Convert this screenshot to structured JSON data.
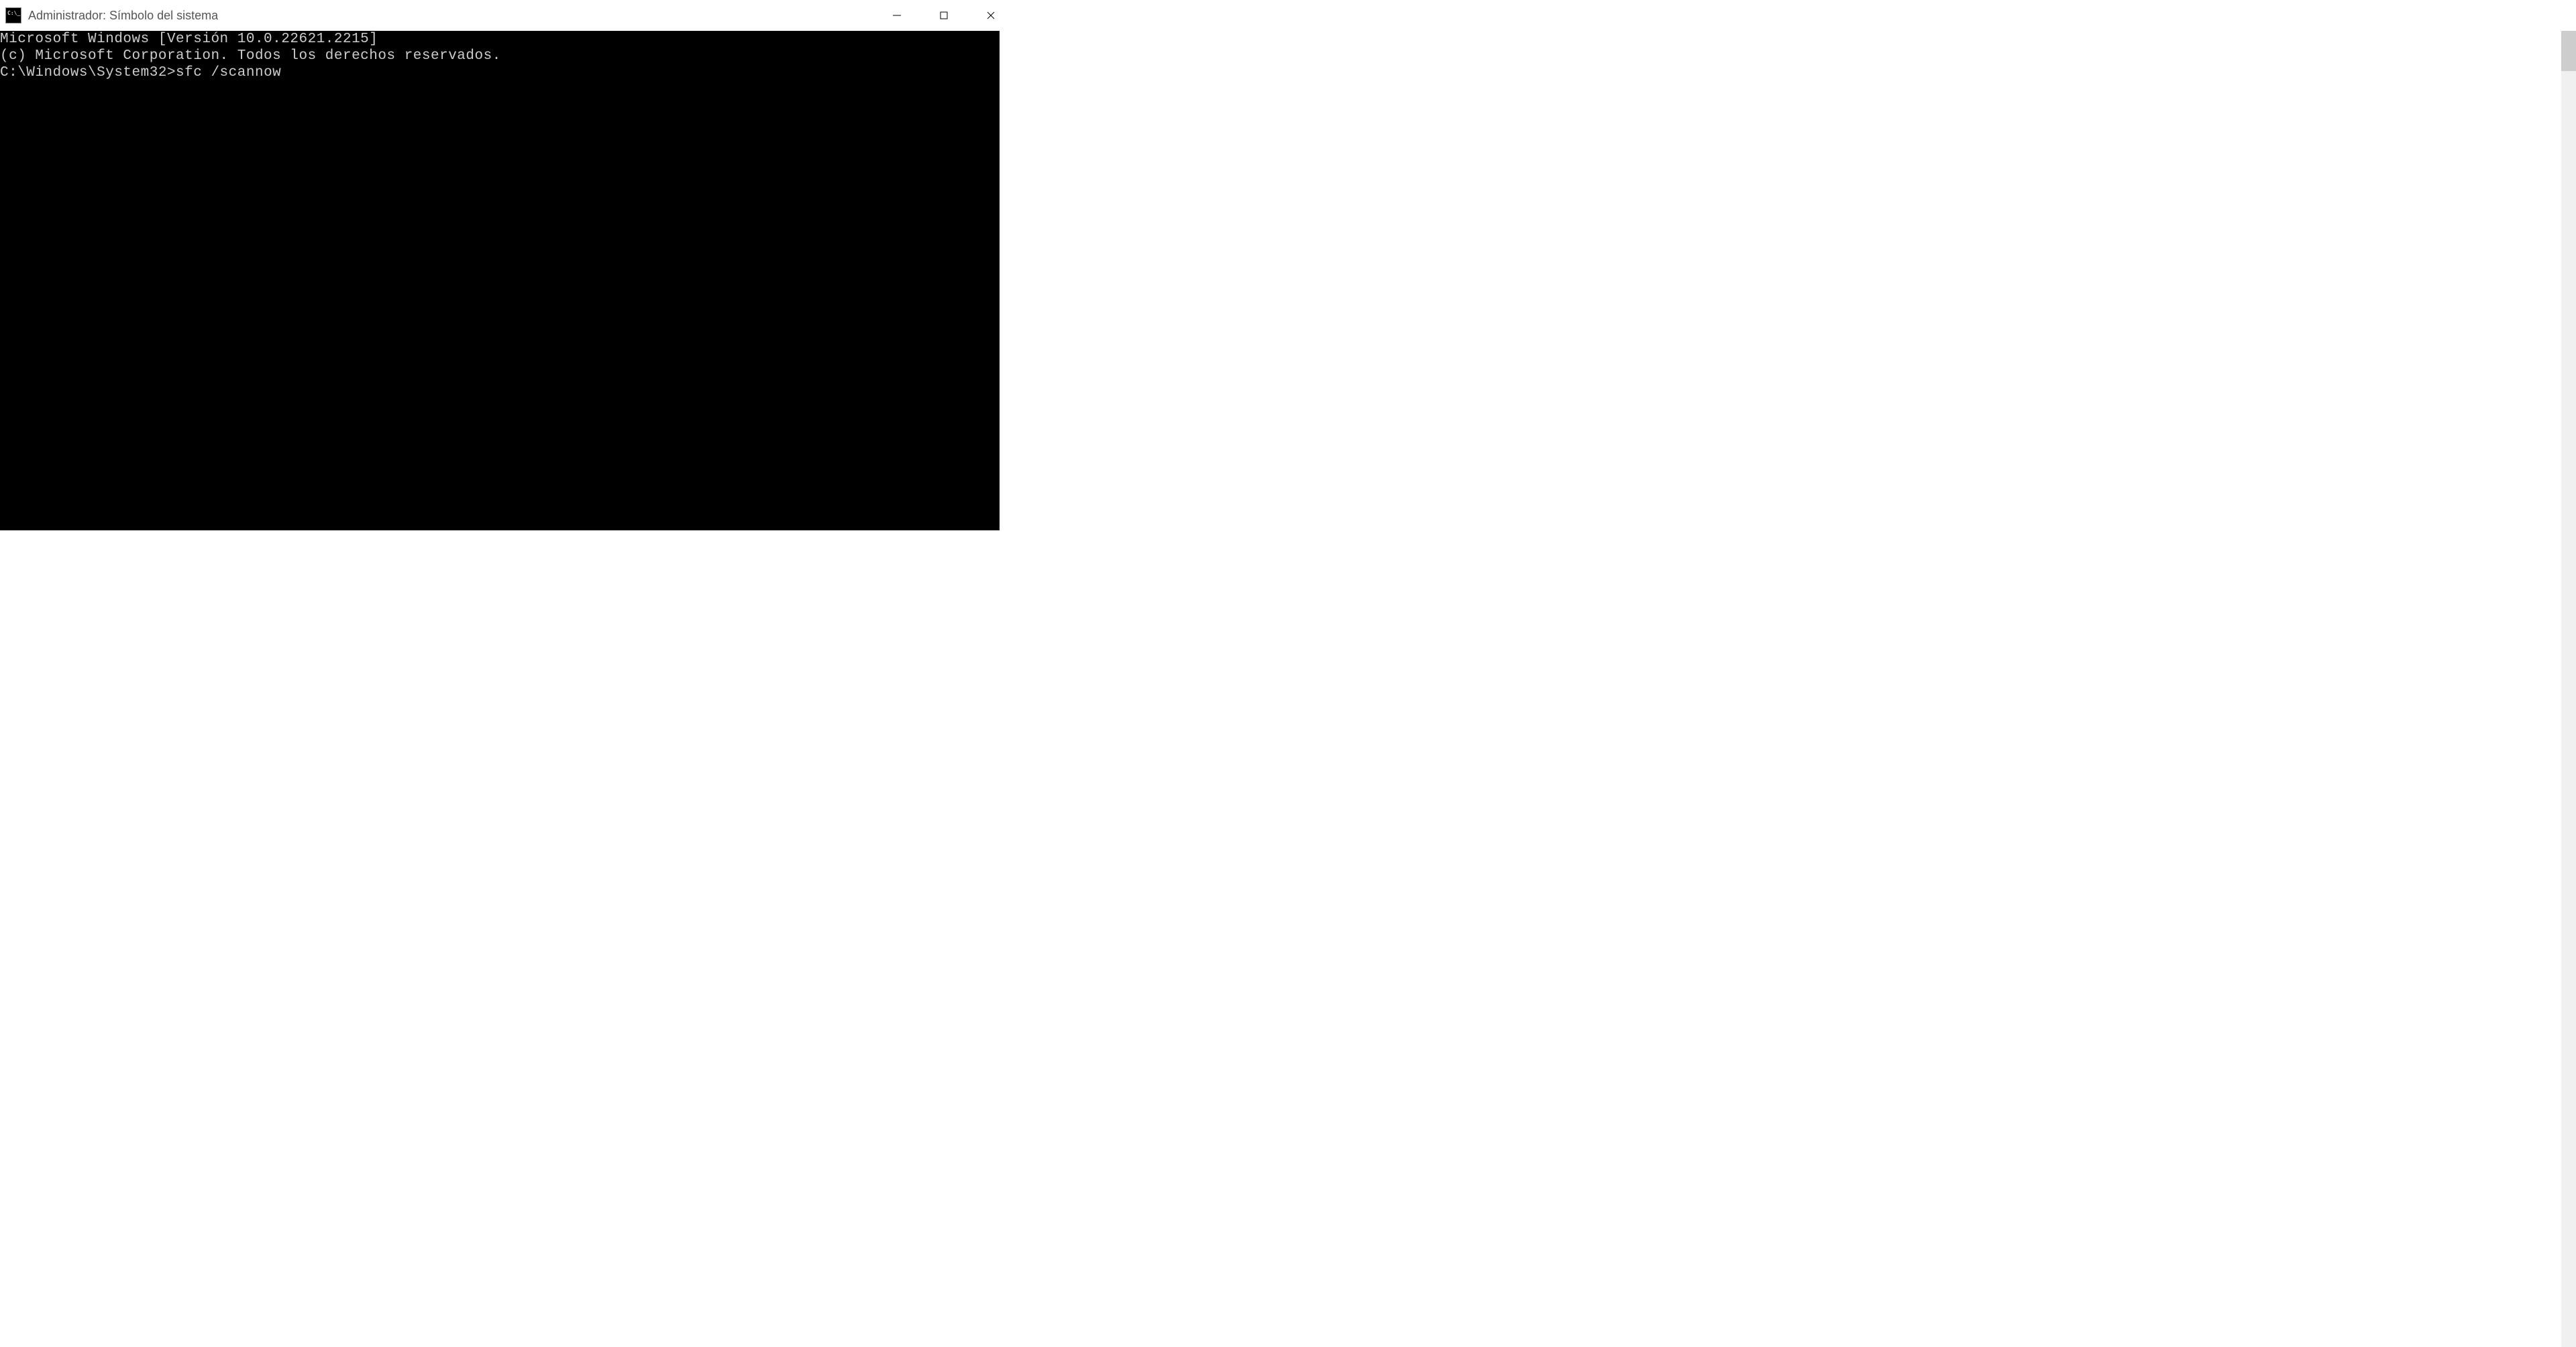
{
  "window": {
    "title": "Administrador: Símbolo del sistema"
  },
  "terminal": {
    "line1": "Microsoft Windows [Versión 10.0.22621.2215]",
    "line2": "(c) Microsoft Corporation. Todos los derechos reservados.",
    "blank": "",
    "prompt": "C:\\Windows\\System32>",
    "command": "sfc /scannow"
  }
}
